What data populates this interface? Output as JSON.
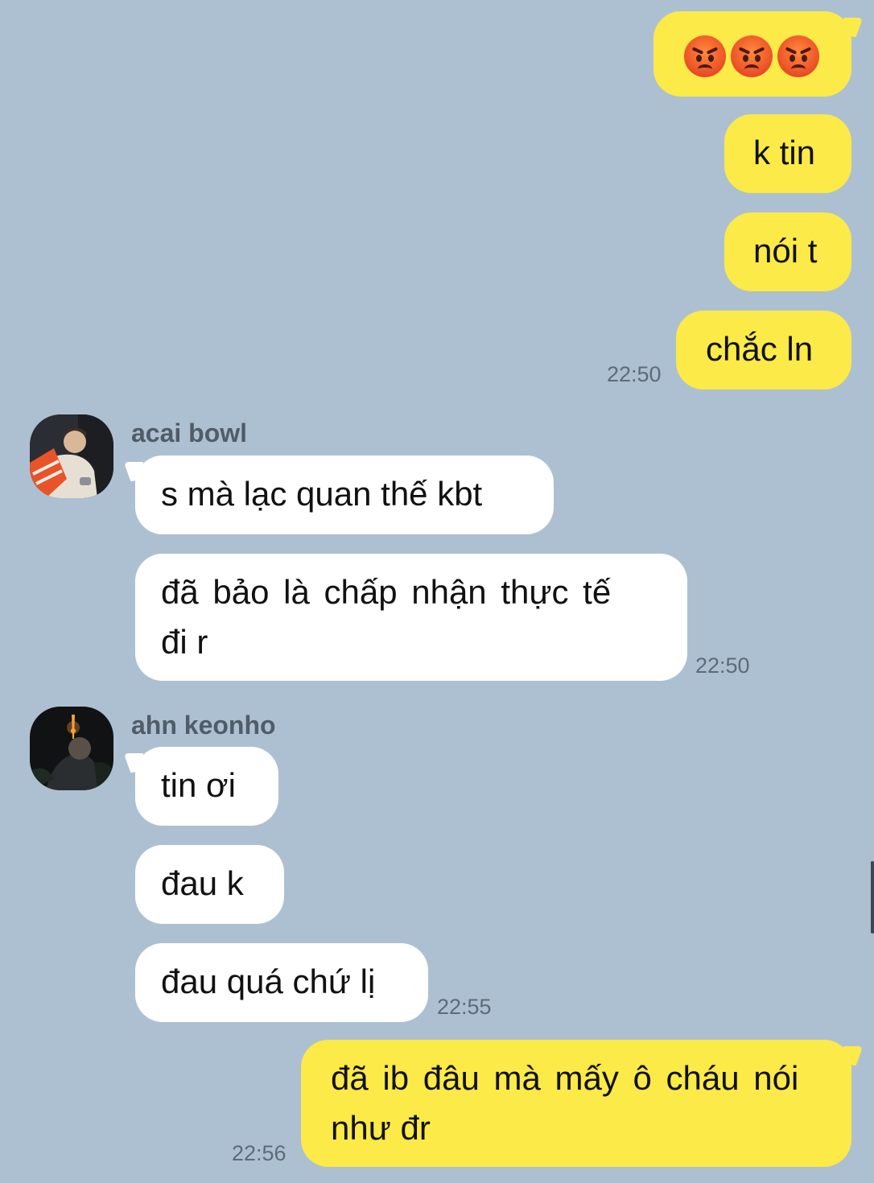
{
  "messages": {
    "m1": {
      "content_icon": "angry-face-emoji x3"
    },
    "m2": {
      "text": "k tin"
    },
    "m3": {
      "text": "nói t"
    },
    "m4": {
      "text": "chắc ln",
      "time": "22:50"
    },
    "acai": {
      "name": "acai bowl",
      "msg1": "s mà lạc quan thế kbt",
      "msg2_line1": "đã bảo là chấp nhận thực tế",
      "msg2_line2": "đi r",
      "time": "22:50"
    },
    "ahn": {
      "name": "ahn keonho",
      "msg1": "tin ơi",
      "msg2": "đau k",
      "msg3": "đau quá chứ lị",
      "time": "22:55"
    },
    "m_last": {
      "line1": "đã ib đâu mà mấy ô cháu nói",
      "line2": "như đr",
      "time": "22:56"
    }
  },
  "colors": {
    "background": "#adc0d2",
    "outgoing_bubble": "#fbea47",
    "incoming_bubble": "#ffffff"
  }
}
